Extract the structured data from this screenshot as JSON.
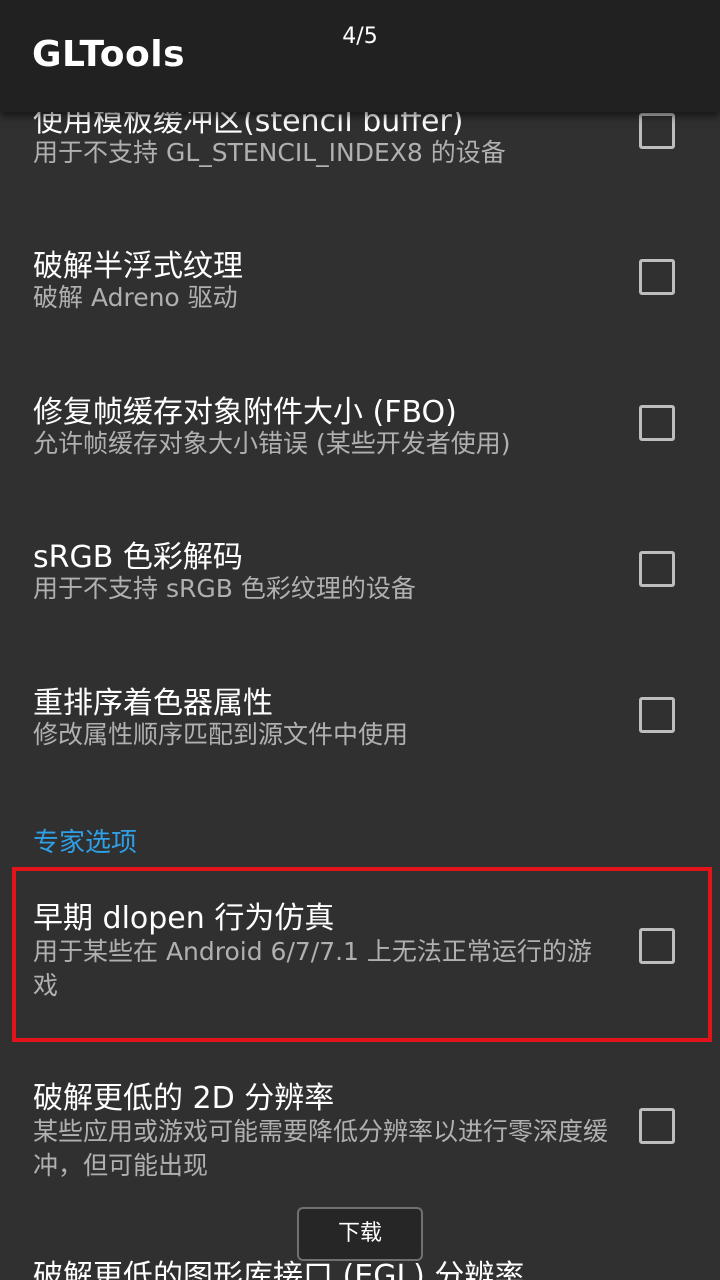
{
  "app": {
    "title": "GLTools",
    "page_indicator": "4/5"
  },
  "items": [
    {
      "title": "使用模板缓冲区(stencil buffer)",
      "summary": "用于不支持 GL_STENCIL_INDEX8 的设备",
      "checked": false
    },
    {
      "title": "破解半浮式纹理",
      "summary": "破解 Adreno 驱动",
      "checked": false
    },
    {
      "title": "修复帧缓存对象附件大小 (FBO)",
      "summary": "允许帧缓存对象大小错误 (某些开发者使用)",
      "checked": false
    },
    {
      "title": "sRGB 色彩解码",
      "summary": "用于不支持 sRGB 色彩纹理的设备",
      "checked": false
    },
    {
      "title": "重排序着色器属性",
      "summary": "修改属性顺序匹配到源文件中使用",
      "checked": false
    }
  ],
  "category": {
    "label": "专家选项",
    "color": "#2f9fe6"
  },
  "expert_items": [
    {
      "title": "早期 dlopen 行为仿真",
      "summary": "用于某些在 Android 6/7/7.1 上无法正常运行的游戏",
      "checked": false
    },
    {
      "title": "破解更低的 2D 分辨率",
      "summary": "某些应用或游戏可能需要降低分辨率以进行零深度缓冲，但可能出现",
      "checked": false
    },
    {
      "title": "破解更低的图形库接口 (EGL) 分辨率",
      "summary": "",
      "checked": false
    }
  ],
  "download_button": {
    "label": "下载"
  },
  "colors": {
    "background": "#303030",
    "appbar": "#212121",
    "highlight": "#e3131c"
  }
}
